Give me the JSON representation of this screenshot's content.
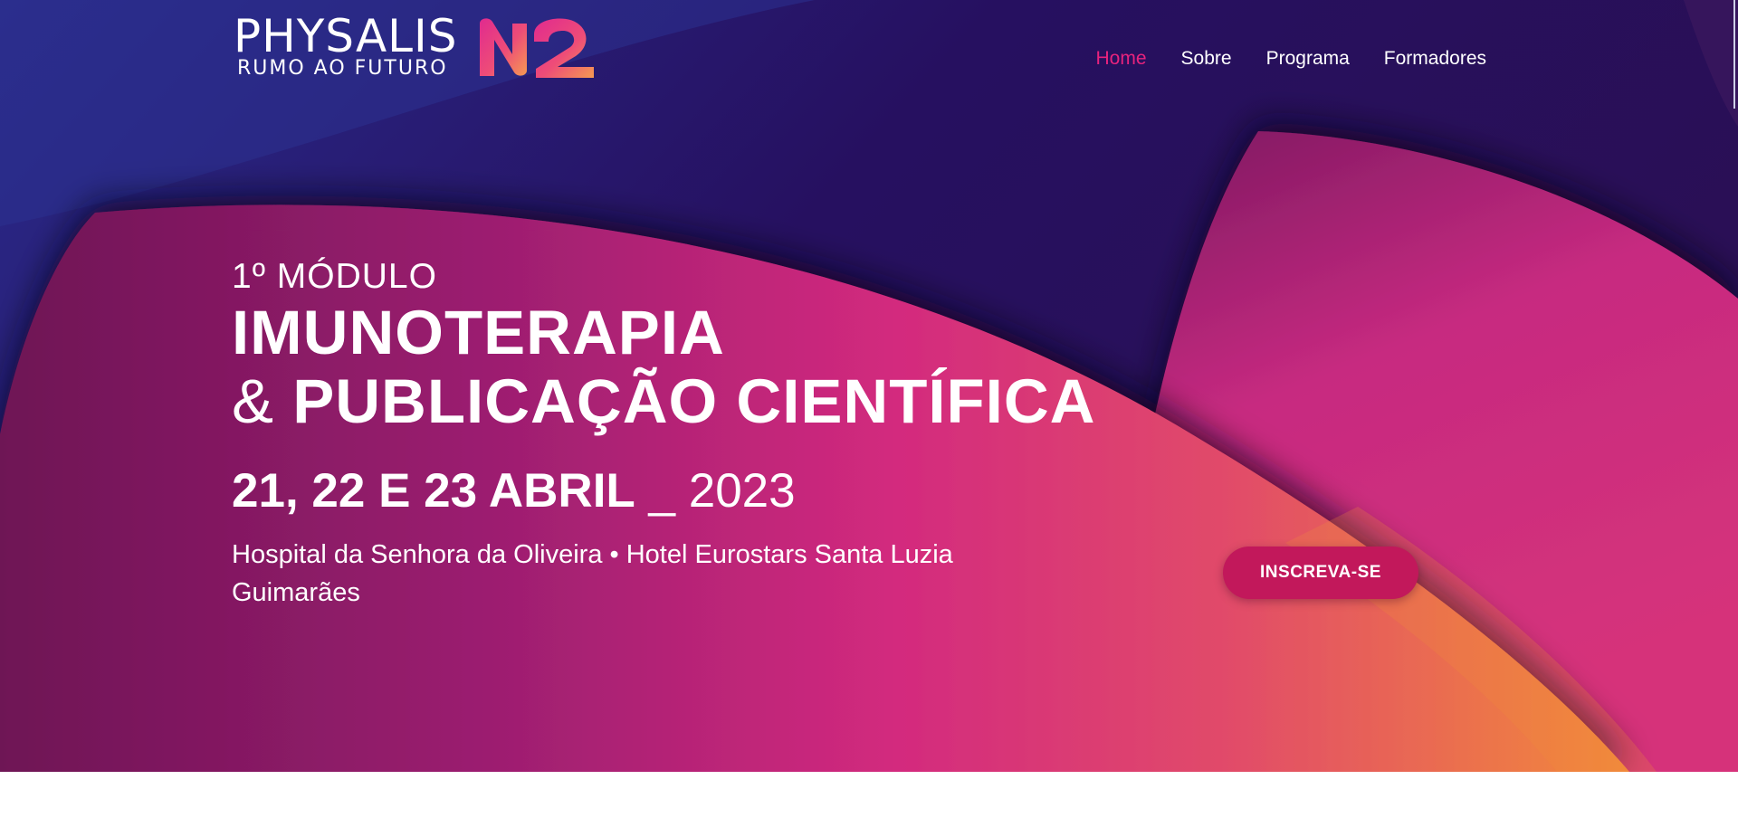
{
  "brand": {
    "name": "PHYSALIS",
    "tagline": "RUMO AO FUTURO",
    "mark": "N2 logo",
    "colors": {
      "pink": "#e8237d",
      "orange": "#f28a3a",
      "navy": "#26105a"
    }
  },
  "nav": {
    "items": [
      {
        "label": "Home",
        "active": true
      },
      {
        "label": "Sobre",
        "active": false
      },
      {
        "label": "Programa",
        "active": false
      },
      {
        "label": "Formadores",
        "active": false
      }
    ],
    "active_color": "#e8237d"
  },
  "hero": {
    "module": "1º MÓDULO",
    "title_line1": "IMUNOTERAPIA",
    "title_amp": "&",
    "title_line2": "PUBLICAÇÃO CIENTÍFICA",
    "dates_strong": "21, 22 E 23 ABRIL",
    "dates_year": "_ 2023",
    "venue_line1": "Hospital da Senhora da Oliveira • Hotel Eurostars Santa Luzia",
    "venue_line2": "Guimarães",
    "cta_label": "INSCREVA-SE",
    "cta_color": "#c2185b"
  }
}
